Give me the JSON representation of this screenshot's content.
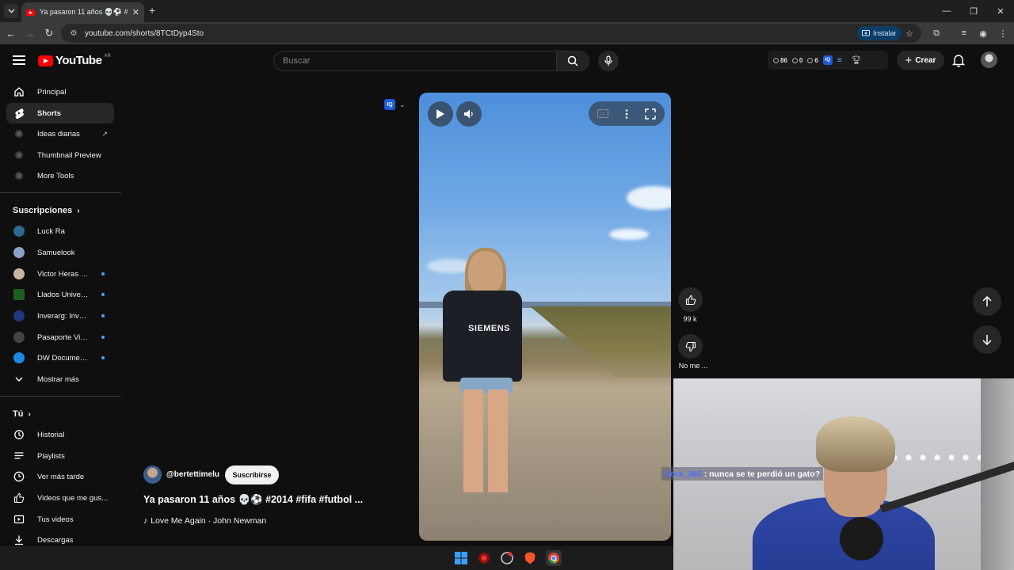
{
  "browser": {
    "tab_title": "Ya pasaron 11 años 💀⚽ #20…",
    "url": "youtube.com/shorts/8TCtDyp4Sto",
    "install_label": "Instalar"
  },
  "masthead": {
    "logo_text": "YouTube",
    "country": "AR",
    "search_placeholder": "Buscar",
    "ext_stats": [
      "86",
      "0",
      "6"
    ],
    "iq_label": "IQ",
    "create_label": "Crear"
  },
  "sidebar": {
    "main": [
      {
        "label": "Principal",
        "icon": "home-icon"
      },
      {
        "label": "Shorts",
        "icon": "shorts-icon",
        "active": true
      },
      {
        "label": "Ideas diarias",
        "icon": "extension-icon"
      },
      {
        "label": "Thumbnail Preview",
        "icon": "extension-icon"
      },
      {
        "label": "More Tools",
        "icon": "extension-icon"
      }
    ],
    "subscriptions_header": "Suscripciones",
    "subscriptions": [
      {
        "label": "Luck Ra",
        "color": "#2d6a8f"
      },
      {
        "label": "Samuelook",
        "color": "#8aa3c4"
      },
      {
        "label": "Victor Heras Me...",
        "color": "#c9b6a2",
        "live": true
      },
      {
        "label": "Llados University",
        "color": "#1b5e20",
        "live": true
      },
      {
        "label": "Inverarg: Invertir ...",
        "color": "#1e3a7a",
        "live": true
      },
      {
        "label": "Pasaporte Viajero",
        "color": "#444444",
        "live": true
      },
      {
        "label": "DW Documental",
        "color": "#1e88e5",
        "live": true
      },
      {
        "label": "Mostrar más",
        "color": ""
      }
    ],
    "you_header": "Tú",
    "you": [
      {
        "label": "Historial",
        "icon": "history-icon"
      },
      {
        "label": "Playlists",
        "icon": "playlist-icon"
      },
      {
        "label": "Ver más tarde",
        "icon": "clock-icon"
      },
      {
        "label": "Videos que me gus...",
        "icon": "like-icon"
      },
      {
        "label": "Tus videos",
        "icon": "video-icon"
      },
      {
        "label": "Descargas",
        "icon": "download-icon"
      }
    ]
  },
  "short": {
    "channel": "@bertettimelu",
    "subscribe_label": "Suscribirse",
    "title": "Ya pasaron 11 años 💀⚽ #2014 #fifa #futbol ...",
    "music": "Love Me Again · John Newman",
    "likes": "99 k",
    "dislike_label": "No me ...",
    "jersey_text": "SIEMENS"
  },
  "webcam": {
    "chat_user": "Sora_365",
    "chat_text": ": nunca se te perdió un gato?"
  },
  "colors": {
    "brand_red": "#ff0000",
    "accent_blue": "#3ea6ff",
    "bg": "#0f0f0f"
  }
}
